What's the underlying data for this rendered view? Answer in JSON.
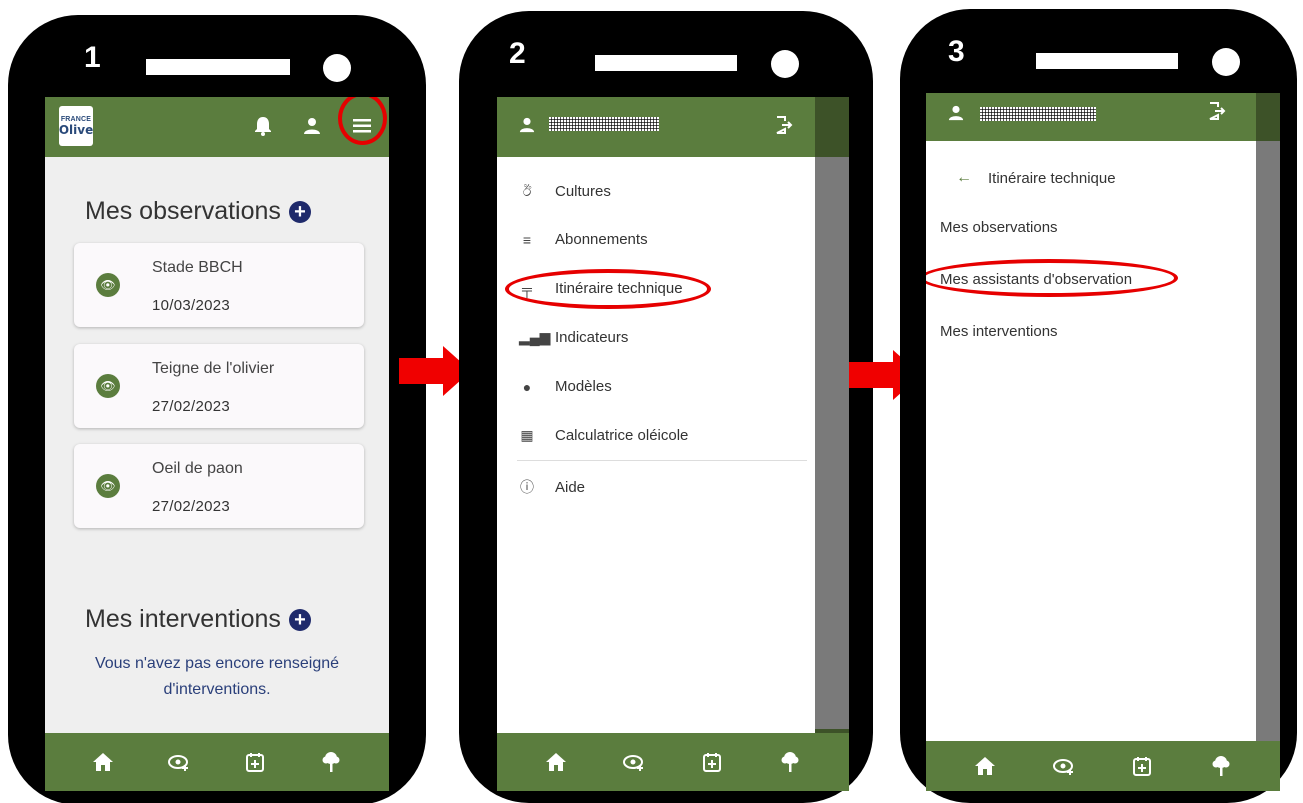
{
  "steps": [
    "1",
    "2",
    "3"
  ],
  "screen1": {
    "logo": {
      "line1": "FRANCE",
      "line2": "Olive"
    },
    "observations_title": "Mes observations",
    "observations": [
      {
        "title": "Stade BBCH",
        "date": "10/03/2023"
      },
      {
        "title": "Teigne de l'olivier",
        "date": "27/02/2023"
      },
      {
        "title": "Oeil de paon",
        "date": "27/02/2023"
      }
    ],
    "interventions_title": "Mes interventions",
    "interventions_empty_line1": "Vous n'avez pas encore renseigné",
    "interventions_empty_line2": "d'interventions."
  },
  "screen2": {
    "menu": [
      {
        "icon": "tractor-icon",
        "label": "Cultures"
      },
      {
        "icon": "list-check-icon",
        "label": "Abonnements"
      },
      {
        "icon": "signpost-icon",
        "label": "Itinéraire technique"
      },
      {
        "icon": "bar-chart-icon",
        "label": "Indicateurs"
      },
      {
        "icon": "models-icon",
        "label": "Modèles"
      },
      {
        "icon": "calculator-icon",
        "label": "Calculatrice oléicole"
      },
      {
        "icon": "help-icon",
        "label": "Aide"
      }
    ]
  },
  "screen3": {
    "back_label": "Itinéraire technique",
    "submenu": [
      "Mes observations",
      "Mes assistants d'observation",
      "Mes interventions"
    ]
  },
  "bottom_nav": [
    "home-icon",
    "observation-add-icon",
    "calendar-add-icon",
    "olive-tree-icon"
  ],
  "colors": {
    "brand_green": "#5b7d3e",
    "highlight_red": "#e60000",
    "accent_navy": "#1f2a6b"
  }
}
